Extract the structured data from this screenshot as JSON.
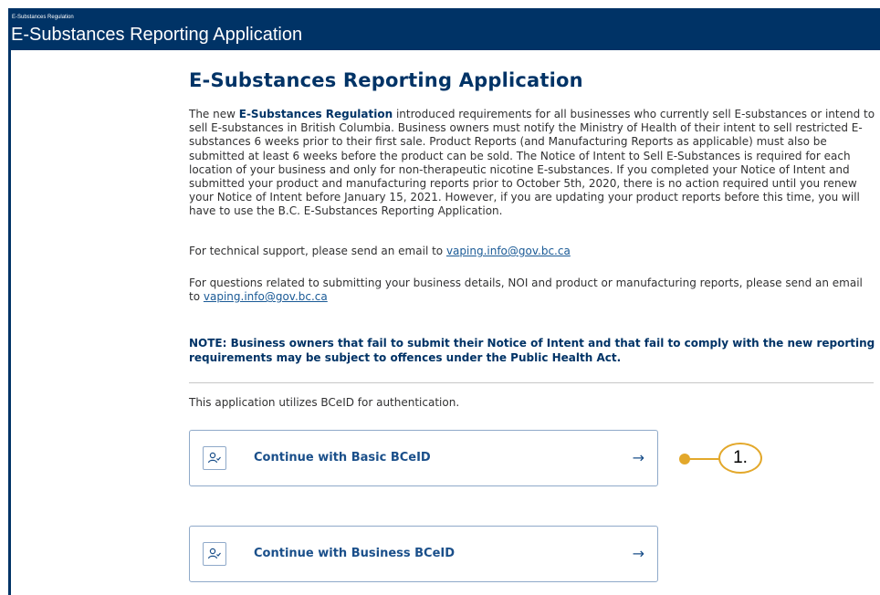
{
  "header": {
    "subtitle": "E-Substances Regulation",
    "title": "E-Substances Reporting Application"
  },
  "main": {
    "page_title": "E-Substances Reporting Application",
    "intro": {
      "lead": "The new ",
      "regulation_link": "E-Substances Regulation",
      "body": " introduced requirements for all businesses who currently sell E-substances or intend to sell E-substances in British Columbia. Business owners must notify the Ministry of Health of their intent to sell restricted E-substances 6 weeks prior to their first sale. Product Reports (and Manufacturing Reports as applicable) must also be submitted at least 6 weeks before the product can be sold. The Notice of Intent to Sell E-Substances is required for each location of your business and only for non-therapeutic nicotine E-substances. If you completed your Notice of Intent and submitted your product and manufacturing reports prior to October 5th, 2020, there is no action required until you renew your Notice of Intent before January 15, 2021. However, if you are updating your product reports before this time, you will have to use the B.C. E-Substances Reporting Application."
    },
    "tech_support": {
      "text": "For technical support, please send an email to ",
      "email": "vaping.info@gov.bc.ca"
    },
    "questions": {
      "text": "For questions related to submitting your business details, NOI and product or manufacturing reports, please send an email to ",
      "email": "vaping.info@gov.bc.ca"
    },
    "note": "NOTE: Business owners that fail to submit their Notice of Intent and that fail to comply with the new reporting requirements may be subject to offences under the Public Health Act.",
    "auth_note": "This application utilizes BCeID for authentication.",
    "buttons": [
      {
        "label": "Continue with Basic BCeID",
        "icon": "user-check-icon",
        "arrow": "→"
      },
      {
        "label": "Continue with Business BCeID",
        "icon": "user-check-icon",
        "arrow": "→"
      }
    ]
  },
  "callout": {
    "number": "1."
  },
  "colors": {
    "header_bg": "#003366",
    "title": "#003366",
    "link": "#1a5a96",
    "callout": "#e3a82b",
    "button_border": "#8fa9c9"
  }
}
